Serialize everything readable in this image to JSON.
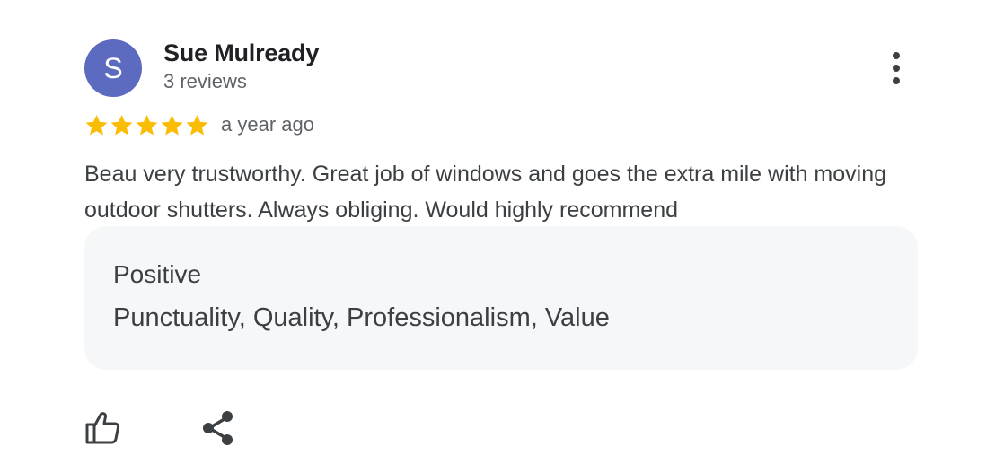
{
  "reviewer": {
    "avatar_letter": "S",
    "avatar_color": "#5c6bc0",
    "name": "Sue Mulready",
    "review_count": "3 reviews"
  },
  "review": {
    "rating": 5,
    "rating_max": 5,
    "star_color": "#fbbc04",
    "date": "a year ago",
    "text": "Beau very trustworthy. Great job of windows and goes the extra mile with moving outdoor shutters. Always obliging. Would highly recommend"
  },
  "attributes": {
    "heading": "Positive",
    "values": "Punctuality, Quality, Professionalism, Value"
  },
  "actions": {
    "more_icon": "more-vert-icon",
    "like_icon": "thumb-up-icon",
    "share_icon": "share-icon"
  }
}
